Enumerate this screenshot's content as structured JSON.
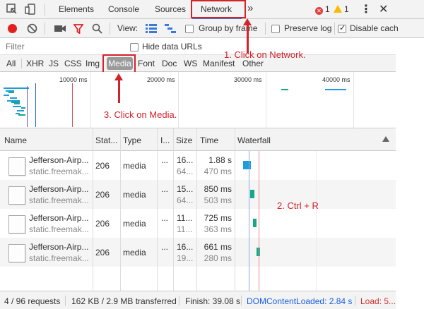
{
  "tabs": {
    "elements": "Elements",
    "console": "Console",
    "sources": "Sources",
    "network": "Network",
    "more": "»"
  },
  "badges": {
    "errors": "1",
    "warnings": "1"
  },
  "toolbar": {
    "view_label": "View:",
    "group_by_frame": "Group by frame",
    "preserve_log": "Preserve log",
    "disable_cache": "Disable cach"
  },
  "filter": {
    "placeholder": "Filter",
    "hide_data_urls": "Hide data URLs"
  },
  "type_filters": [
    "All",
    "XHR",
    "JS",
    "CSS",
    "Img",
    "Media",
    "Font",
    "Doc",
    "WS",
    "Manifest",
    "Other"
  ],
  "overview": {
    "ticks": [
      "10000 ms",
      "20000 ms",
      "30000 ms",
      "40000 ms"
    ]
  },
  "table": {
    "headers": [
      "Name",
      "Stat...",
      "Type",
      "I...",
      "Size",
      "Time",
      "Waterfall"
    ],
    "rows": [
      {
        "name": "Jefferson-Airp...",
        "domain": "static.freemak...",
        "status": "206",
        "type": "media",
        "initiator": "...",
        "size": "16...",
        "size2": "64...",
        "time": "1.88 s",
        "latency": "470 ms"
      },
      {
        "name": "Jefferson-Airp...",
        "domain": "static.freemak...",
        "status": "206",
        "type": "media",
        "initiator": "...",
        "size": "15...",
        "size2": "64...",
        "time": "850 ms",
        "latency": "503 ms"
      },
      {
        "name": "Jefferson-Airp...",
        "domain": "static.freemak...",
        "status": "206",
        "type": "media",
        "initiator": "...",
        "size": "11...",
        "size2": "11...",
        "time": "725 ms",
        "latency": "363 ms"
      },
      {
        "name": "Jefferson-Airp...",
        "domain": "static.freemak...",
        "status": "206",
        "type": "media",
        "initiator": "...",
        "size": "16...",
        "size2": "19...",
        "time": "661 ms",
        "latency": "280 ms"
      }
    ]
  },
  "status": {
    "requests": "4 / 96 requests",
    "transferred": "162 KB / 2.9 MB transferred",
    "finish": "Finish: 39.08 s",
    "dcl": "DOMContentLoaded: 2.84 s",
    "load": "Load: 5..."
  },
  "annotations": {
    "step1": "1. Click on Network.",
    "step2": "2. Ctrl + R",
    "step3": "3. Click on Media."
  },
  "colors": {
    "accent": "#3879d9",
    "annotation_red": "#d2232a",
    "waterfall_blue": "#1e9dd8",
    "waterfall_teal": "#13a88a",
    "dcl_line": "#1a62e0",
    "load_line": "#e05050"
  }
}
